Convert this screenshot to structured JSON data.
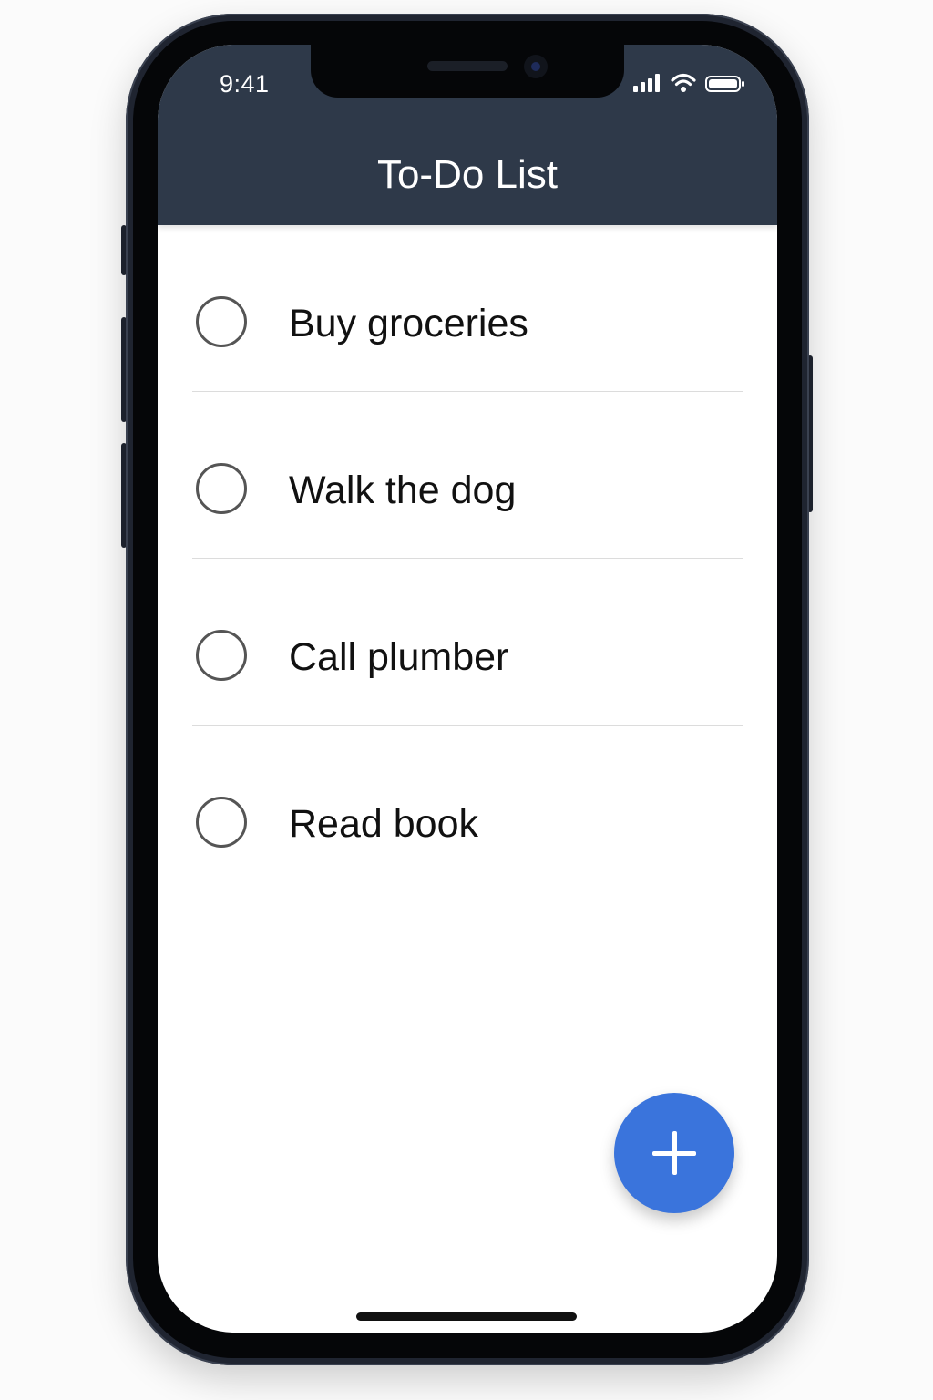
{
  "status_bar": {
    "time": "9:41",
    "icons": [
      "cellular-signal-icon",
      "wifi-icon",
      "battery-icon"
    ]
  },
  "header": {
    "title": "To-Do List",
    "background": "#2e3949"
  },
  "todos": [
    {
      "label": "Buy groceries",
      "done": false
    },
    {
      "label": "Walk the dog",
      "done": false
    },
    {
      "label": "Call plumber",
      "done": false
    },
    {
      "label": "Read book",
      "done": false
    }
  ],
  "fab": {
    "icon": "plus-icon",
    "color": "#3a74dc"
  }
}
